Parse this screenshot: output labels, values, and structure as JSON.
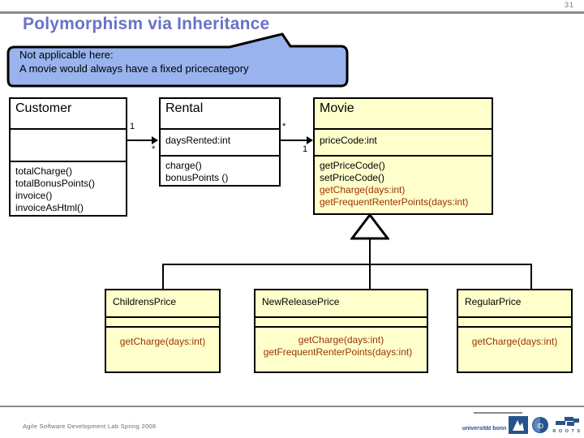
{
  "slide": {
    "page_number": "31",
    "title": "Polymorphism via Inheritance",
    "accent_color": "#6a72c8"
  },
  "callout": {
    "line1": "Not applicable here:",
    "line2": "A movie would always have a fixed pricecategory",
    "fill_color": "#99b3ee",
    "border_color": "#000000"
  },
  "diagram": {
    "type": "uml-class-diagram",
    "classes": [
      {
        "id": "customer",
        "name": "Customer",
        "fill": "#ffffff",
        "attributes": [],
        "operations": [
          "totalCharge()",
          "totalBonusPoints()",
          "invoice()",
          "invoiceAsHtml()"
        ]
      },
      {
        "id": "rental",
        "name": "Rental",
        "fill": "#ffffff",
        "attributes": [
          "daysRented:int"
        ],
        "operations": [
          "charge()",
          "bonusPoints ()"
        ]
      },
      {
        "id": "movie",
        "name": "Movie",
        "fill": "#ffffcc",
        "attributes": [
          "priceCode:int"
        ],
        "operations": [
          "getPriceCode()",
          "setPriceCode()",
          "getCharge(days:int)",
          "getFrequentRenterPoints(days:int)"
        ],
        "operations_highlighted": [
          "getCharge(days:int)",
          "getFrequentRenterPoints(days:int)"
        ]
      },
      {
        "id": "childrens-price",
        "name": "ChildrensPrice",
        "fill": "#ffffcc",
        "attributes": [],
        "operations": [
          "getCharge(days:int)"
        ]
      },
      {
        "id": "new-release-price",
        "name": "NewReleasePrice",
        "fill": "#ffffcc",
        "attributes": [],
        "operations": [
          "getCharge(days:int)",
          "getFrequentRenterPoints(days:int)"
        ]
      },
      {
        "id": "regular-price",
        "name": "RegularPrice",
        "fill": "#ffffcc",
        "attributes": [],
        "operations": [
          "getCharge(days:int)"
        ]
      }
    ],
    "associations": [
      {
        "from": "Customer",
        "to": "Rental",
        "source_multiplicity": "1",
        "target_multiplicity": "*"
      },
      {
        "from": "Rental",
        "to": "Movie",
        "source_multiplicity": "*",
        "target_multiplicity": "1"
      }
    ],
    "generalization": {
      "parent": "Movie",
      "children": [
        "ChildrensPrice",
        "NewReleasePrice",
        "RegularPrice"
      ]
    },
    "highlight_color": "#993300"
  },
  "footer": {
    "text": "Agile Software Development Lab Spring 2008",
    "university": "universität bonn",
    "roots_label": "R O O T S"
  }
}
